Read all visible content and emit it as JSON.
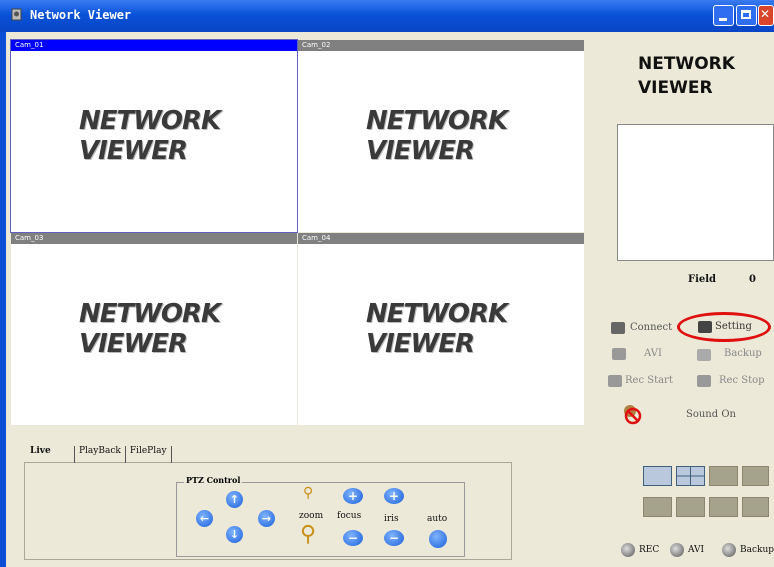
{
  "window": {
    "title": "Network Viewer"
  },
  "cameras": [
    {
      "label": "Cam_01",
      "logo_line1": "NETWORK",
      "logo_line2": "VIEWER",
      "active": true
    },
    {
      "label": "Cam_02",
      "logo_line1": "NETWORK",
      "logo_line2": "VIEWER",
      "active": false
    },
    {
      "label": "Cam_03",
      "logo_line1": "NETWORK",
      "logo_line2": "VIEWER",
      "active": false
    },
    {
      "label": "Cam_04",
      "logo_line1": "NETWORK",
      "logo_line2": "VIEWER",
      "active": false
    }
  ],
  "right_panel": {
    "logo_line1": "NETWORK",
    "logo_line2": "VIEWER",
    "field_label": "Field",
    "field_value": "0",
    "connect_label": "Connect",
    "setting_label": "Setting",
    "avi_label": "AVI",
    "backup_label": "Backup",
    "rec_start_label": "Rec Start",
    "rec_stop_label": "Rec Stop",
    "sound_label": "Sound On",
    "highlight_color": "#e01010",
    "radios": [
      "REC",
      "AVI",
      "Backup"
    ]
  },
  "tabs": [
    "Live",
    "PlayBack",
    "FilePlay"
  ],
  "ptz": {
    "title": "PTZ Control",
    "zoom_label": "zoom",
    "focus_label": "focus",
    "iris_label": "iris",
    "auto_label": "auto"
  }
}
